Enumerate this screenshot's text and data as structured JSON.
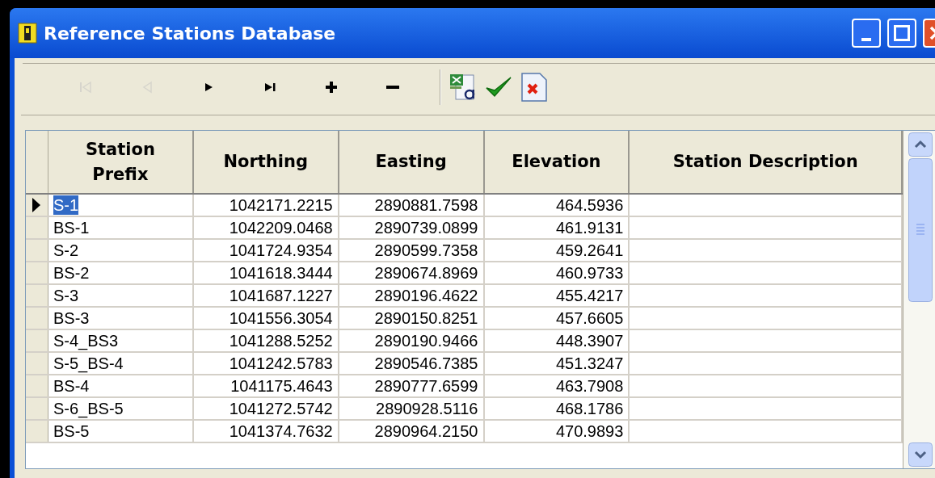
{
  "window": {
    "title": "Reference Stations Database"
  },
  "toolbar": [
    {
      "kind": "first",
      "disabled": true
    },
    {
      "kind": "previous",
      "disabled": true
    },
    {
      "kind": "next",
      "disabled": false
    },
    {
      "kind": "last",
      "disabled": false
    },
    {
      "kind": "add",
      "disabled": false
    },
    {
      "kind": "delete",
      "disabled": false
    },
    {
      "kind": "separator"
    },
    {
      "kind": "export",
      "disabled": false
    },
    {
      "kind": "confirm",
      "disabled": false
    },
    {
      "kind": "cancel",
      "disabled": false
    }
  ],
  "table": {
    "columns": [
      "Station Prefix",
      "Northing",
      "Easting",
      "Elevation",
      "Station Description"
    ],
    "rows": [
      {
        "selected": true,
        "cells": [
          "S-1",
          "1042171.2215",
          "2890881.7598",
          "464.5936"
        ]
      },
      {
        "selected": false,
        "cells": [
          "BS-1",
          "1042209.0468",
          "2890739.0899",
          "461.9131"
        ]
      },
      {
        "selected": false,
        "cells": [
          "S-2",
          "1041724.9354",
          "2890599.7358",
          "459.2641"
        ]
      },
      {
        "selected": false,
        "cells": [
          "BS-2",
          "1041618.3444",
          "2890674.8969",
          "460.9733"
        ]
      },
      {
        "selected": false,
        "cells": [
          "S-3",
          "1041687.1227",
          "2890196.4622",
          "455.4217"
        ]
      },
      {
        "selected": false,
        "cells": [
          "BS-3",
          "1041556.3054",
          "2890150.8251",
          "457.6605"
        ]
      },
      {
        "selected": false,
        "cells": [
          "S-4_BS3",
          "1041288.5252",
          "2890190.9466",
          "448.3907"
        ]
      },
      {
        "selected": false,
        "cells": [
          "S-5_BS-4",
          "1041242.5783",
          "2890546.7385",
          "451.3247"
        ]
      },
      {
        "selected": false,
        "cells": [
          "BS-4",
          "1041175.4643",
          "2890777.6599",
          "463.7908"
        ]
      },
      {
        "selected": false,
        "cells": [
          "S-6_BS-5",
          "1041272.5742",
          "2890928.5116",
          "468.1786"
        ]
      },
      {
        "selected": false,
        "cells": [
          "BS-5",
          "1041374.7632",
          "2890964.2150",
          "470.9893"
        ]
      }
    ]
  }
}
